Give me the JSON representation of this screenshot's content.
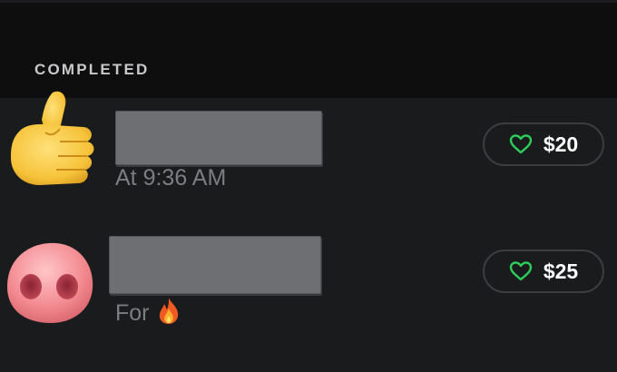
{
  "section": {
    "label": "COMPLETED"
  },
  "rows": [
    {
      "avatar": "thumbs-up-emoji",
      "subtitle": "At 9:36 AM",
      "tip": {
        "amount": "$20",
        "icon": "heart-outline-icon"
      }
    },
    {
      "avatar": "pig-nose-emoji",
      "subtitle": "For",
      "subtitle_emoji": "fire-emoji",
      "tip": {
        "amount": "$25",
        "icon": "heart-outline-icon"
      }
    }
  ],
  "colors": {
    "accent": "#2ecc5a",
    "background": "#1a1b1d",
    "header_background": "#0e0e0f"
  }
}
